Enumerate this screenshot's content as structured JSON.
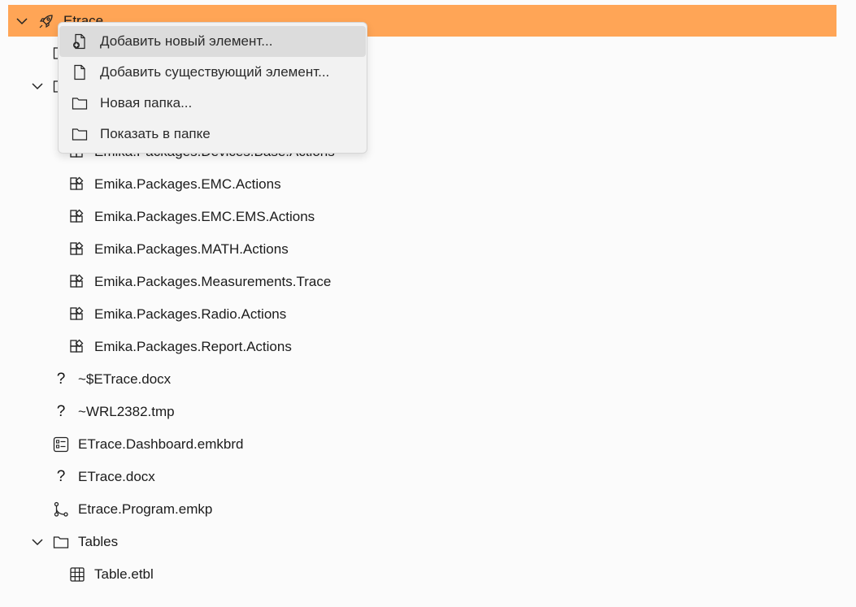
{
  "tree": {
    "root": {
      "label": "Etrace"
    },
    "hidden_rows": [
      {
        "label": ""
      },
      {
        "label": ""
      }
    ],
    "packages": [
      {
        "label": "Emika.Packages.Devices.Base.Actions"
      },
      {
        "label": "Emika.Packages.EMC.Actions"
      },
      {
        "label": "Emika.Packages.EMC.EMS.Actions"
      },
      {
        "label": "Emika.Packages.MATH.Actions"
      },
      {
        "label": "Emika.Packages.Measurements.Trace"
      },
      {
        "label": "Emika.Packages.Radio.Actions"
      },
      {
        "label": "Emika.Packages.Report.Actions"
      }
    ],
    "files": [
      {
        "label": "~$ETrace.docx",
        "icon": "unknown-file-icon"
      },
      {
        "label": "~WRL2382.tmp",
        "icon": "unknown-file-icon"
      },
      {
        "label": "ETrace.Dashboard.emkbrd",
        "icon": "dashboard-icon"
      },
      {
        "label": "ETrace.docx",
        "icon": "unknown-file-icon"
      },
      {
        "label": "Etrace.Program.emkp",
        "icon": "program-flow-icon"
      }
    ],
    "tables_folder": {
      "label": "Tables"
    },
    "tables": [
      {
        "label": "Table.etbl"
      }
    ]
  },
  "context_menu": {
    "items": [
      {
        "label": "Добавить новый элемент...",
        "icon": "add-file-icon"
      },
      {
        "label": "Добавить существующий элемент...",
        "icon": "file-icon"
      },
      {
        "label": "Новая папка...",
        "icon": "folder-icon"
      },
      {
        "label": "Показать в папке",
        "icon": "folder-icon"
      }
    ]
  },
  "colors": {
    "selection": "#ffa556",
    "menu_bg": "#f2f2f2",
    "menu_hover": "#dcdcdc"
  }
}
